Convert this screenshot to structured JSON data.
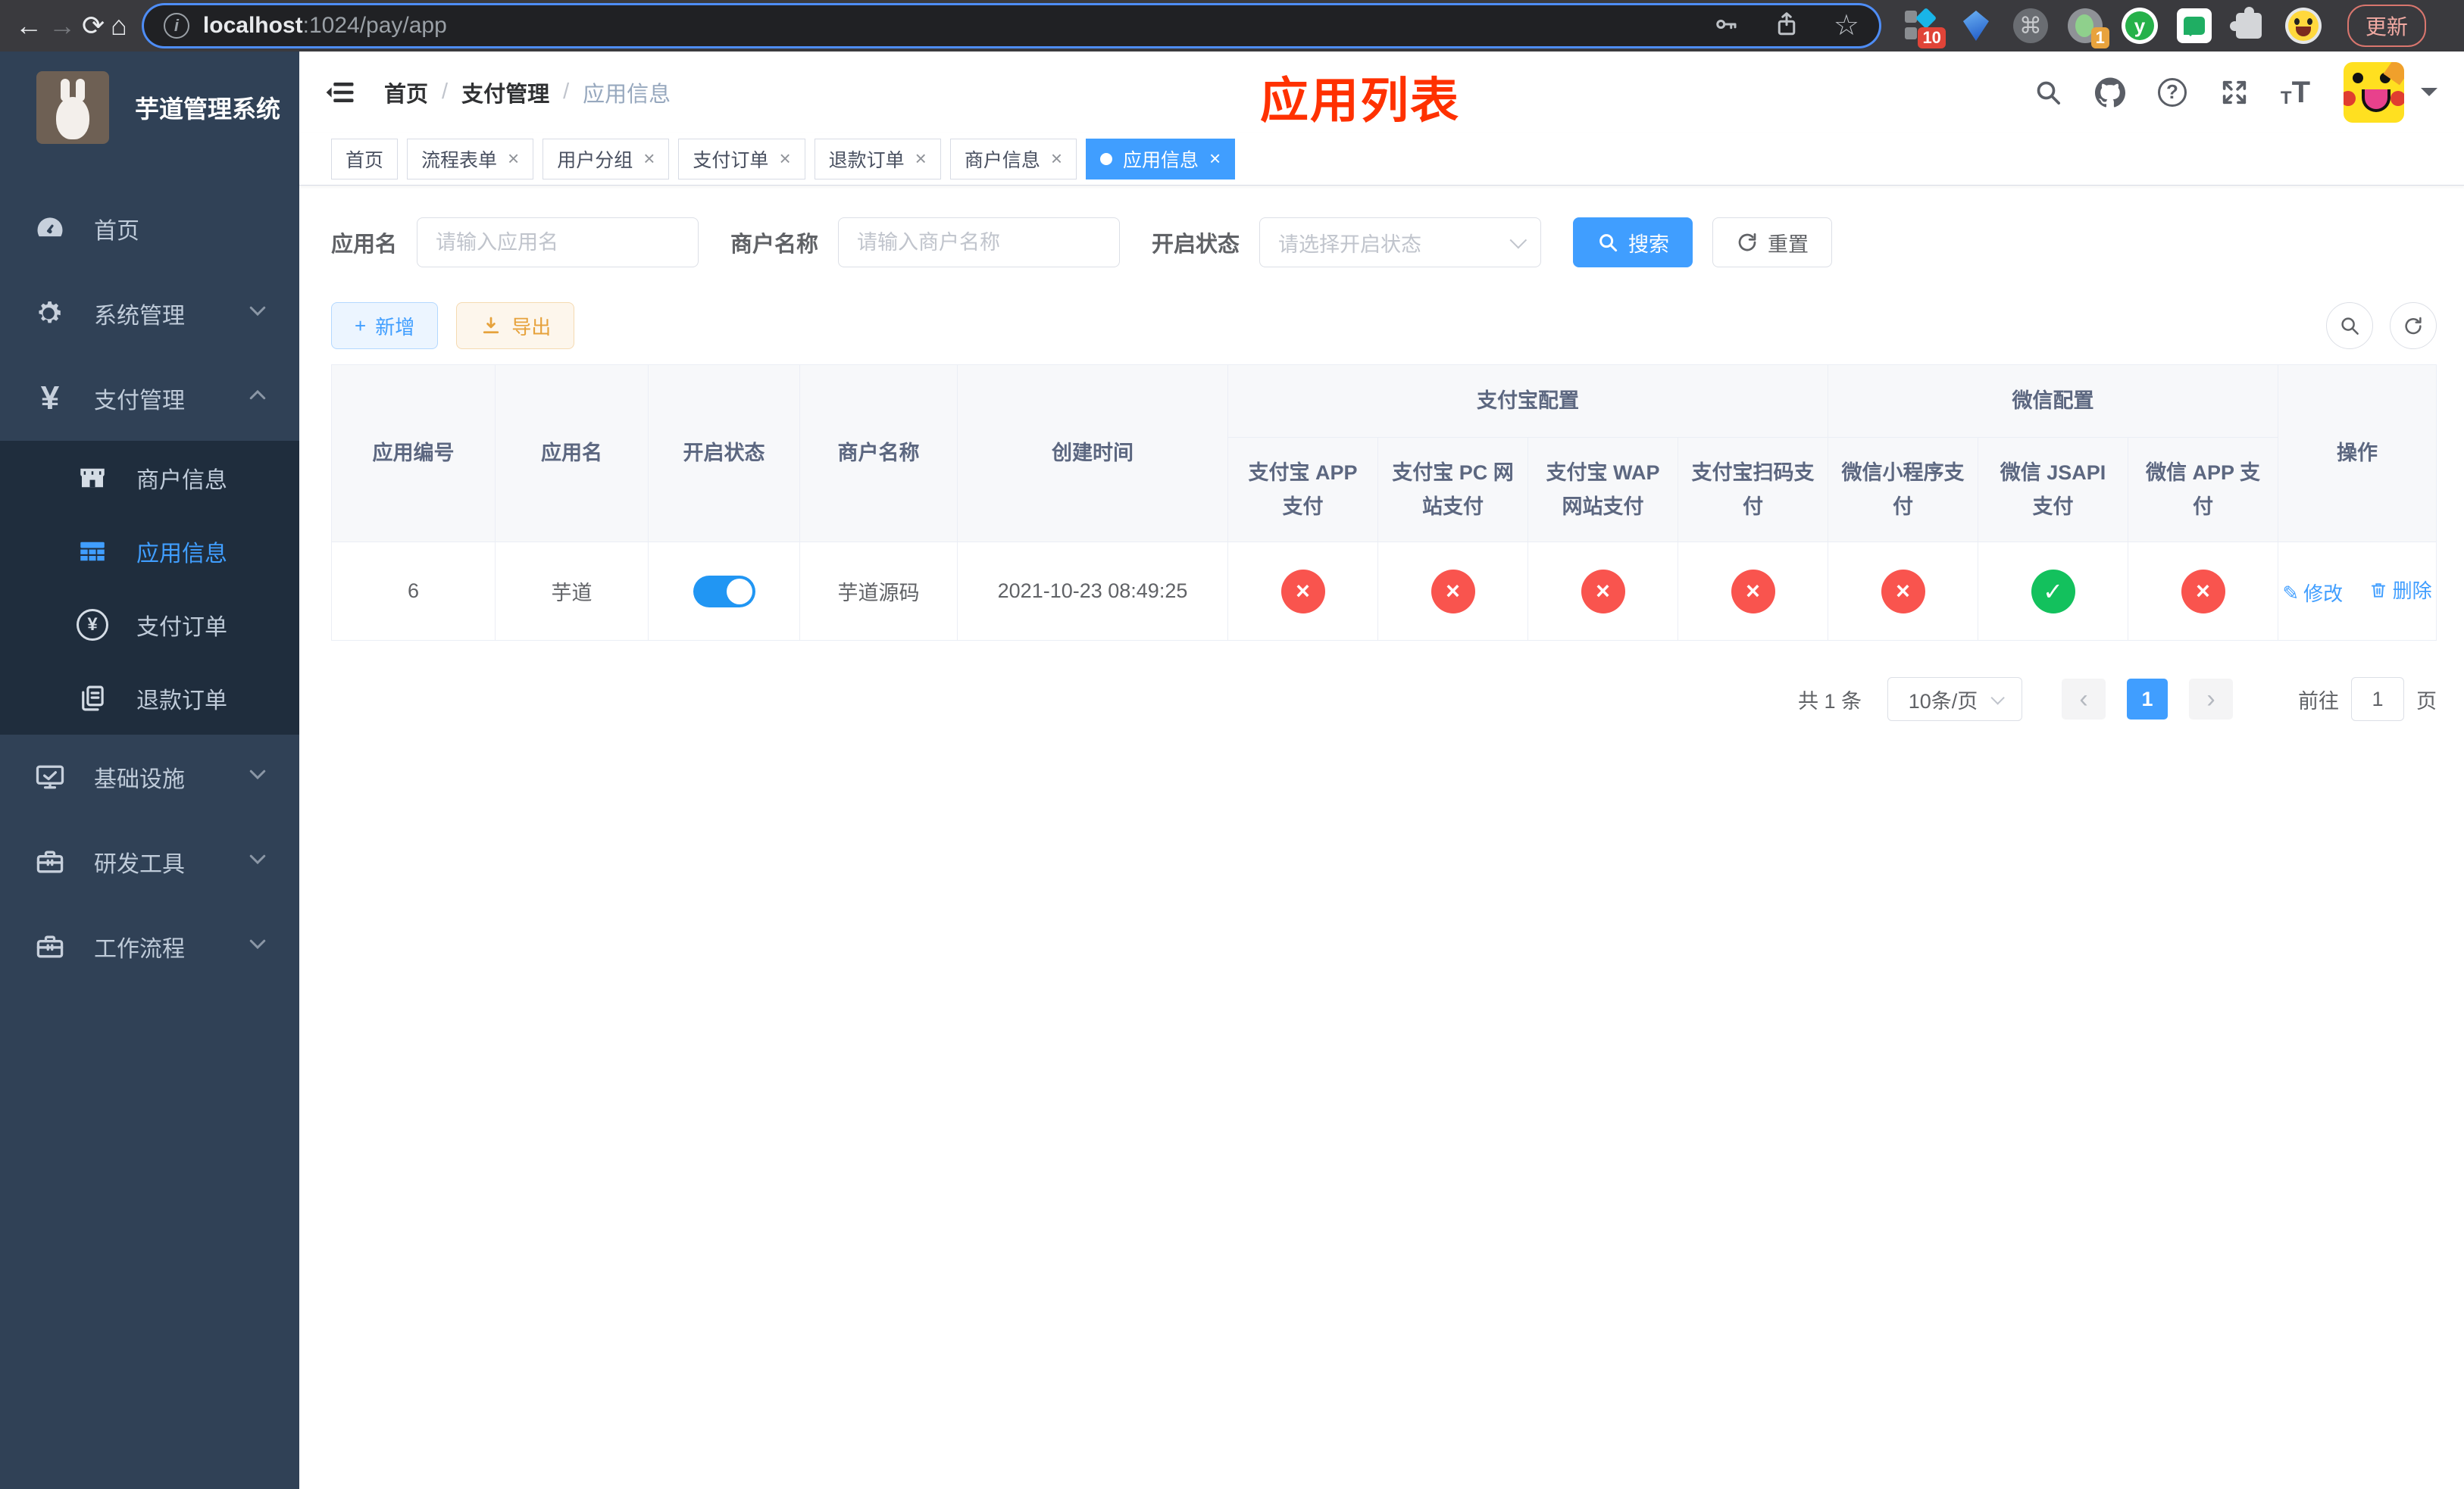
{
  "browser": {
    "url": {
      "host": "localhost",
      "path": ":1024/pay/app"
    },
    "update_label": "更新",
    "ext_badge_count": "10",
    "ext_badge_one": "1",
    "ext_y_letter": "y"
  },
  "glyphs": {
    "back": "←",
    "forward": "→",
    "reload": "⟳",
    "home": "⌂",
    "info": "i",
    "star": "☆",
    "command": "⌘",
    "dots": "⋮",
    "question": "?",
    "yen": "¥",
    "check": "✓",
    "cross": "×",
    "close": "×",
    "prev": "‹",
    "next": "›",
    "pencil": "✎",
    "plus": "+",
    "text_small": "T",
    "text_large": "T"
  },
  "sidebar": {
    "title": "芋道管理系统",
    "menu": [
      {
        "label": "首页"
      },
      {
        "label": "系统管理"
      },
      {
        "label": "支付管理"
      },
      {
        "label": "基础设施"
      },
      {
        "label": "研发工具"
      },
      {
        "label": "工作流程"
      }
    ],
    "submenu": [
      {
        "label": "商户信息"
      },
      {
        "label": "应用信息",
        "active": true
      },
      {
        "label": "支付订单"
      },
      {
        "label": "退款订单"
      }
    ]
  },
  "header": {
    "breadcrumb": {
      "0": "首页",
      "1": "支付管理",
      "2": "应用信息",
      "sep": "/"
    },
    "annotation_title": "应用列表"
  },
  "tabs": {
    "items": [
      {
        "label": "首页",
        "closable": false
      },
      {
        "label": "流程表单",
        "closable": true
      },
      {
        "label": "用户分组",
        "closable": true
      },
      {
        "label": "支付订单",
        "closable": true
      },
      {
        "label": "退款订单",
        "closable": true
      },
      {
        "label": "商户信息",
        "closable": true
      },
      {
        "label": "应用信息",
        "closable": true,
        "active": true
      }
    ]
  },
  "filters": {
    "app_name": {
      "label": "应用名",
      "placeholder": "请输入应用名",
      "value": ""
    },
    "merchant": {
      "label": "商户名称",
      "placeholder": "请输入商户名称",
      "value": ""
    },
    "status": {
      "label": "开启状态",
      "placeholder": "请选择开启状态"
    },
    "search_label": "搜索",
    "reset_label": "重置"
  },
  "toolbar": {
    "add_label": "新增",
    "export_label": "导出"
  },
  "table": {
    "columns": {
      "id": "应用编号",
      "name": "应用名",
      "enabled": "开启状态",
      "merchant": "商户名称",
      "created": "创建时间",
      "ops": "操作"
    },
    "groups": {
      "alipay": "支付宝配置",
      "wechat": "微信配置"
    },
    "sub_columns": {
      "0": "支付宝 APP 支付",
      "1": "支付宝 PC 网站支付",
      "2": "支付宝 WAP 网站支付",
      "3": "支付宝扫码支付",
      "4": "微信小程序支付",
      "5": "微信 JSAPI 支付",
      "6": "微信 APP 支付"
    },
    "row": {
      "id": "6",
      "name": "芋道",
      "enabled": true,
      "merchant": "芋道源码",
      "created": "2021-10-23 08:49:25",
      "statuses": [
        false,
        false,
        false,
        false,
        false,
        true,
        false
      ],
      "edit_label": "修改",
      "delete_label": "删除"
    }
  },
  "pagination": {
    "total": "共 1 条",
    "page_size": "10条/页",
    "current": "1",
    "goto_label": "前往",
    "goto_value": "1",
    "page_unit": "页"
  },
  "colors": {
    "accent": "#409eff",
    "danger": "#f9544e",
    "success": "#13c15d",
    "annotation": "#ff3100",
    "sidebar": "#304156",
    "submenu": "#1f2d3d"
  }
}
